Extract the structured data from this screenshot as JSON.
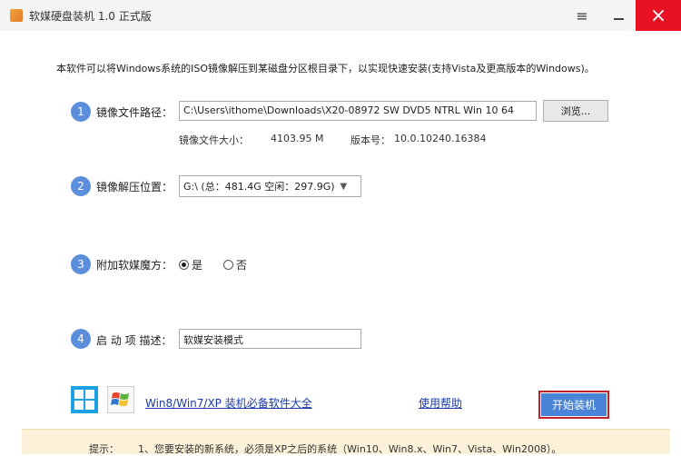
{
  "window": {
    "title": "软媒硬盘装机 1.0 正式版",
    "menu_icon": "hamburger-icon",
    "minimize_icon": "minimize-icon",
    "close_icon": "close-icon",
    "close_glyph": "×",
    "menu_glyph": "≡"
  },
  "intro": "本软件可以将Windows系统的ISO镜像解压到某磁盘分区根目录下，以实现快速安装(支持Vista及更高版本的Windows)。",
  "step1": {
    "number": "1",
    "label": "镜像文件路径：",
    "path_value": "C:\\Users\\ithome\\Downloads\\X20-08972 SW DVD5 NTRL Win 10 64",
    "browse_label": "浏览...",
    "size_label": "镜像文件大小：",
    "size_value": "4103.95 M",
    "version_label": "版本号：",
    "version_value": "10.0.10240.16384"
  },
  "step2": {
    "number": "2",
    "label": "镜像解压位置：",
    "selected": "G:\\ (总：481.4G 空闲：297.9G)"
  },
  "step3": {
    "number": "3",
    "label": "附加软媒魔方：",
    "option_yes": "是",
    "option_no": "否",
    "selected": "是"
  },
  "step4": {
    "number": "4",
    "label": "启 动 项 描述：",
    "value": "软媒安装模式"
  },
  "footer": {
    "software_link": "Win8/Win7/XP 装机必备软件大全",
    "help_link": "使用帮助",
    "start_button": "开始装机"
  },
  "tip": {
    "label": "提示：",
    "text": "1、您要安装的新系统，必须是XP之后的系统（Win10、Win8.x、Win7、Vista、Win2008）。"
  },
  "colors": {
    "accent": "#4a84d6",
    "step_circle": "#5b8fdb",
    "close": "#e81123",
    "highlight_border": "#c4202a",
    "tip_background": "#fbf1d9",
    "link": "#1a3aa8"
  }
}
